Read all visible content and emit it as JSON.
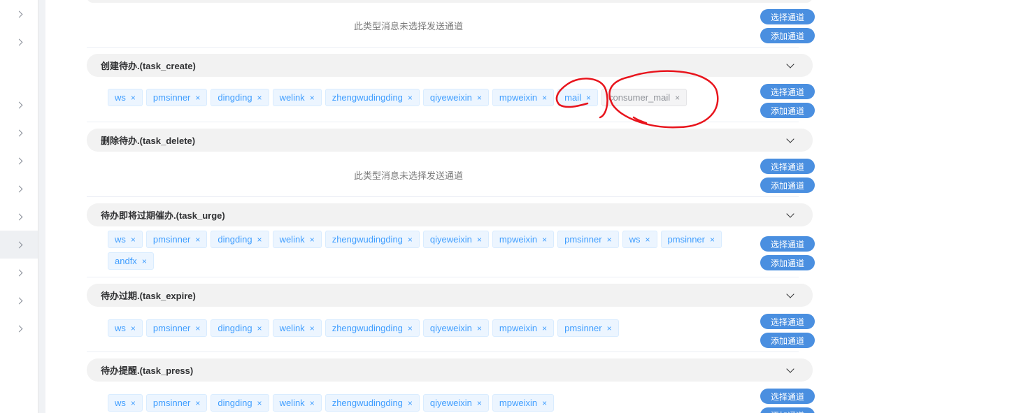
{
  "sidebar": {
    "items": [
      {
        "icon": "chevron-right-icon"
      },
      {
        "icon": "chevron-right-icon"
      },
      {
        "icon": "chevron-right-icon"
      },
      {
        "icon": "chevron-right-icon"
      },
      {
        "icon": "chevron-right-icon"
      },
      {
        "icon": "chevron-right-icon"
      },
      {
        "icon": "chevron-right-icon"
      },
      {
        "icon": "chevron-right-icon"
      },
      {
        "icon": "chevron-right-icon"
      },
      {
        "icon": "chevron-right-icon"
      },
      {
        "icon": "chevron-right-icon"
      }
    ]
  },
  "labels": {
    "select_channel": "选择通道",
    "add_channel": "添加通道",
    "no_channel": "此类型消息未选择发送通道",
    "close_glyph": "×"
  },
  "sections": [
    {
      "title": "创建待办.(task_create)",
      "tags": [
        {
          "label": "ws"
        },
        {
          "label": "pmsinner"
        },
        {
          "label": "dingding"
        },
        {
          "label": "welink"
        },
        {
          "label": "zhengwudingding"
        },
        {
          "label": "qiyeweixin"
        },
        {
          "label": "mpweixin"
        },
        {
          "label": "mail"
        },
        {
          "label": "consumer_mail",
          "style": "gray"
        }
      ]
    },
    {
      "title": "删除待办.(task_delete)",
      "tags": []
    },
    {
      "title": "待办即将过期催办.(task_urge)",
      "tags": [
        {
          "label": "ws"
        },
        {
          "label": "pmsinner"
        },
        {
          "label": "dingding"
        },
        {
          "label": "welink"
        },
        {
          "label": "zhengwudingding"
        },
        {
          "label": "qiyeweixin"
        },
        {
          "label": "mpweixin"
        },
        {
          "label": "pmsinner"
        },
        {
          "label": "ws"
        },
        {
          "label": "pmsinner"
        },
        {
          "label": "andfx"
        }
      ]
    },
    {
      "title": "待办过期.(task_expire)",
      "tags": [
        {
          "label": "ws"
        },
        {
          "label": "pmsinner"
        },
        {
          "label": "dingding"
        },
        {
          "label": "welink"
        },
        {
          "label": "zhengwudingding"
        },
        {
          "label": "qiyeweixin"
        },
        {
          "label": "mpweixin"
        },
        {
          "label": "pmsinner"
        }
      ]
    },
    {
      "title": "待办提醒.(task_press)",
      "tags": [
        {
          "label": "ws"
        },
        {
          "label": "pmsinner"
        },
        {
          "label": "dingding"
        },
        {
          "label": "welink"
        },
        {
          "label": "zhengwudingding"
        },
        {
          "label": "qiyeweixin"
        },
        {
          "label": "mpweixin"
        }
      ]
    }
  ],
  "colors": {
    "tag_text": "#409eff",
    "tag_bg": "#ecf5ff",
    "button_bg": "#4a8fe0",
    "header_bg": "#f2f2f2",
    "annotation": "#e8141c"
  }
}
